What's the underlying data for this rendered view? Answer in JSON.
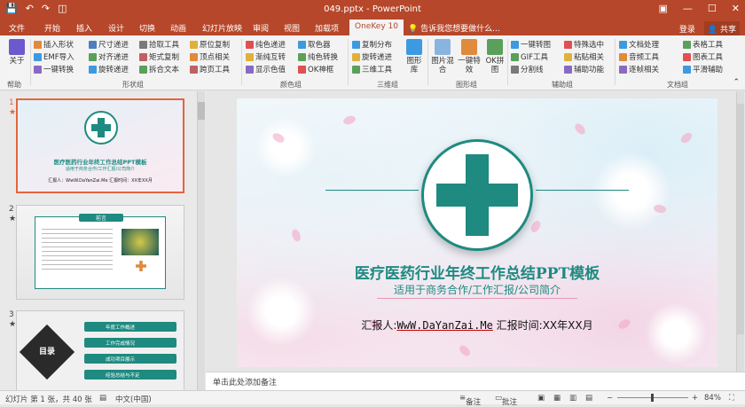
{
  "window": {
    "doc_title": "049.pptx - PowerPoint",
    "qat_icons": [
      "save-icon",
      "undo-icon",
      "redo-icon",
      "present-icon"
    ],
    "qat_glyphs": [
      "💾",
      "↶",
      "↷",
      "◫"
    ],
    "win_buttons": [
      "▣",
      "—",
      "☐",
      "✕"
    ]
  },
  "tabs": {
    "items": [
      "文件",
      "开始",
      "插入",
      "设计",
      "切换",
      "动画",
      "幻灯片放映",
      "审阅",
      "视图",
      "加载项",
      "OneKey 10"
    ],
    "active": "OneKey 10",
    "search": "告诉我您想要做什么...",
    "login": "登录",
    "share": "共享"
  },
  "ribbon": {
    "about": {
      "label": "关于",
      "group": "帮助"
    },
    "shape_group": {
      "items": [
        "插入形状",
        "尺寸递进",
        "拾取工具",
        "原位复制",
        "EMF导入",
        "对齐递进",
        "矩式复制",
        "顶点相关",
        "一键转换",
        "旋转递进",
        "拆合文本",
        "跨页工具"
      ],
      "label": "形状组"
    },
    "color_group": {
      "items": [
        "纯色递进",
        "取色器",
        "渐纯互转",
        "纯色转换",
        "显示色值",
        "OK神框"
      ],
      "label": "颜色组"
    },
    "threed_group": {
      "items": [
        "复制分布",
        "旋转递进",
        "三维工具"
      ],
      "big": "图形库",
      "label": "三维组"
    },
    "image_group": {
      "big": [
        "图片混合",
        "一键特效",
        "OK拼图"
      ],
      "label": "图形组"
    },
    "aux_group": {
      "items": [
        "一键转图",
        "特殊选中",
        "GIF工具",
        "粘贴相关",
        "分割线",
        "辅助功能"
      ],
      "label": "辅助组"
    },
    "doc_group": {
      "items": [
        "文档处理",
        "表格工具",
        "音频工具",
        "图表工具",
        "逐帧相关",
        "平滑辅助"
      ],
      "label": "文档组"
    }
  },
  "thumbnails": [
    {
      "num": "1",
      "star": "★",
      "title": "医疗医药行业年终工作总结PPT模板",
      "subtitle": "适用于商务合作/工作汇报/公司简介",
      "reporter": "汇报人：WwW.DaYanZai.Me 汇报时间：XX年XX月"
    },
    {
      "num": "2",
      "star": "★",
      "heading": "前言"
    },
    {
      "num": "3",
      "star": "★",
      "toc": "目录",
      "items": [
        "年度工作概述",
        "工作完成情况",
        "成功项目展示",
        "经验总结与不足"
      ]
    }
  ],
  "slide": {
    "title": "医疗医药行业年终工作总结PPT模板",
    "subtitle": "适用于商务合作/工作汇报/公司简介",
    "reporter_label": "汇报人:",
    "reporter_value": "WwW.DaYanZai.Me",
    "time_label": "汇报时间:XX年XX月"
  },
  "notes": {
    "placeholder": "单击此处添加备注"
  },
  "statusbar": {
    "slide_info": "幻灯片 第 1 张，共 40 张",
    "language": "中文(中国)",
    "notes_btn": "备注",
    "comments_btn": "批注",
    "zoom": "84%"
  },
  "colors": {
    "accent": "#b7472a",
    "teal": "#1e8a80"
  }
}
